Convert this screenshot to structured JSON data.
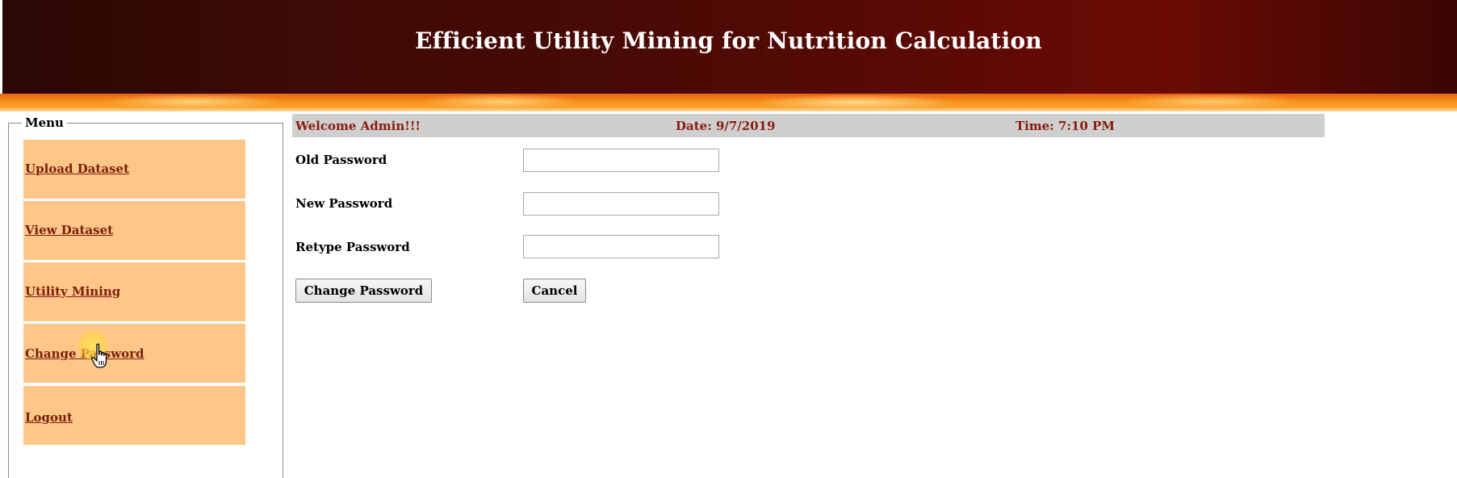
{
  "header": {
    "title": "Efficient Utility Mining for Nutrition Calculation"
  },
  "menu": {
    "legend": "Menu",
    "items": [
      {
        "label": "Upload Dataset"
      },
      {
        "label": "View Dataset"
      },
      {
        "label": "Utility Mining"
      },
      {
        "label": "Change Password"
      },
      {
        "label": "Logout"
      }
    ]
  },
  "info_bar": {
    "welcome": "Welcome Admin!!!",
    "date": "Date: 9/7/2019",
    "time": "Time: 7:10 PM"
  },
  "form": {
    "old_password_label": "Old Password",
    "old_password_value": "",
    "new_password_label": "New Password",
    "new_password_value": "",
    "retype_password_label": "Retype Password",
    "retype_password_value": "",
    "change_button": "Change Password",
    "cancel_button": "Cancel"
  },
  "colors": {
    "menu_item_bg": "#fec688",
    "link": "#7b1e0a",
    "info_text": "#8b1a0c",
    "info_bar_bg": "#cfcfcf"
  },
  "cursor": {
    "icon": "hand-pointer-icon",
    "hovering": "Change Password"
  }
}
